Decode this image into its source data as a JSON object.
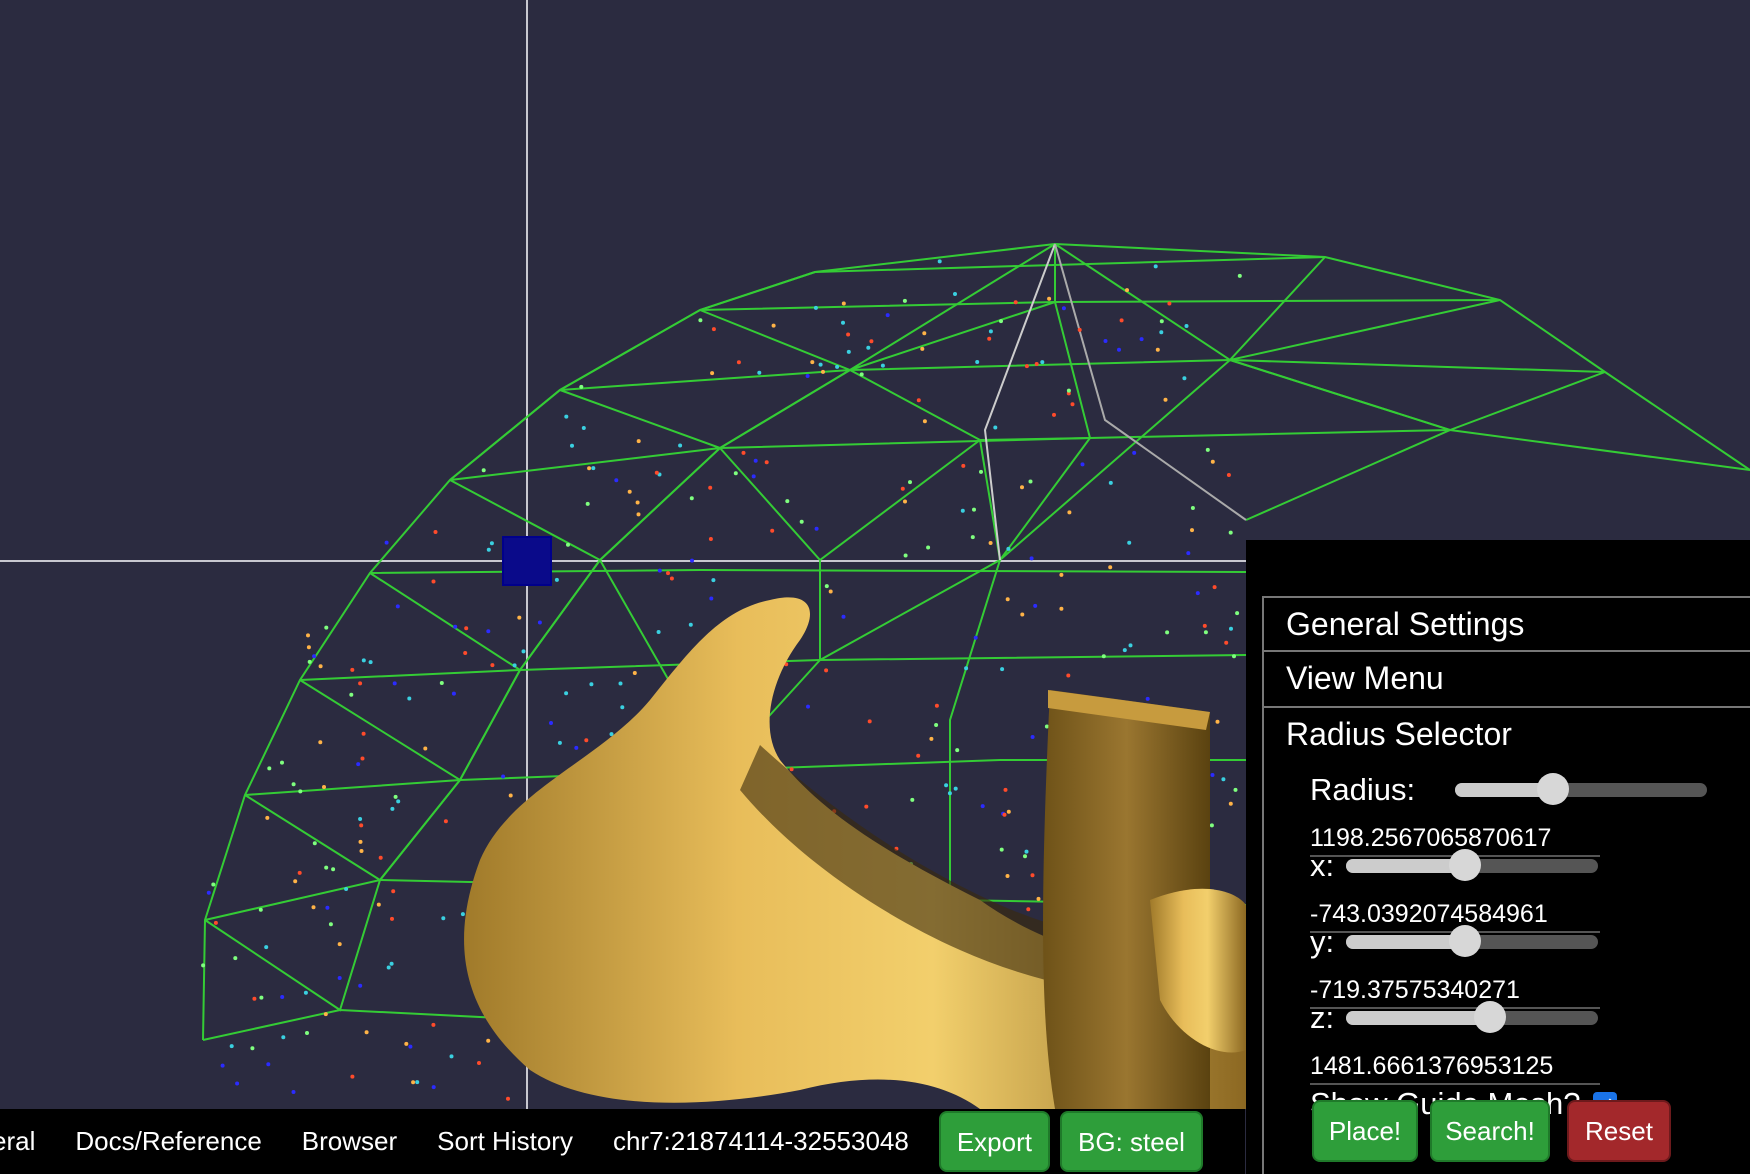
{
  "toolbar": {
    "items": [
      "eral",
      "Docs/Reference",
      "Browser",
      "Sort History",
      "chr7:21874114-32553048"
    ],
    "export_label": "Export",
    "bg_label": "BG: steel"
  },
  "panel": {
    "general_settings": "General Settings",
    "view_menu": "View Menu",
    "radius_selector": "Radius Selector",
    "radius": {
      "label": "Radius:",
      "value": "1198.2567065870617",
      "level": 0.39
    },
    "x": {
      "label": "x:",
      "value": "-743.0392074584961",
      "level": 0.47
    },
    "y": {
      "label": "y:",
      "value": "-719.37575340271",
      "level": 0.47
    },
    "z": {
      "label": "z:",
      "value": "1481.6661376953125",
      "level": 0.57
    },
    "guide_mesh_label": "Show Guide Mesh?",
    "guide_mesh_checked": true,
    "place_label": "Place!",
    "search_label": "Search!",
    "reset_label": "Reset"
  },
  "colors": {
    "background": "#2b2b40",
    "mesh": "#33dd33",
    "tube": "#d9aa48",
    "button_green": "#2e9e3a",
    "button_red": "#a3282b"
  }
}
